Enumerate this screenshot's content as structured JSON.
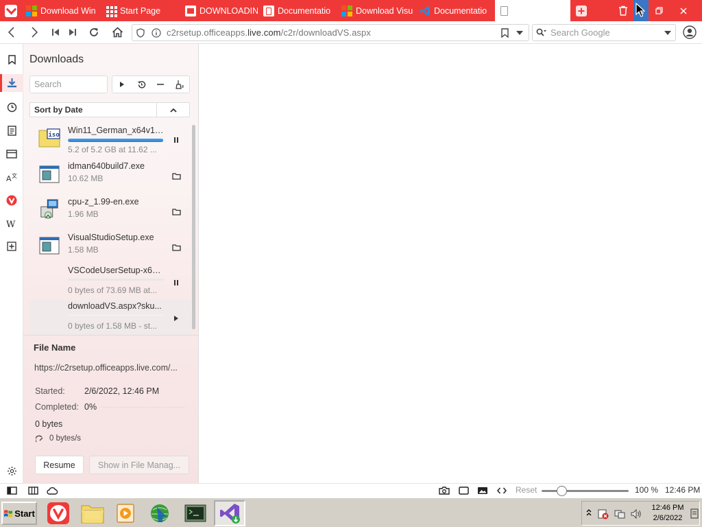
{
  "window": {
    "tabs": [
      {
        "title": "Download Win",
        "icon": "microsoft-logo-icon"
      },
      {
        "title": "Start Page",
        "icon": "speed-dial-grid-icon"
      },
      {
        "title": "DOWNLOADIN",
        "icon": "download-site-favicon"
      },
      {
        "title": "Documentatio",
        "icon": "document-favicon"
      },
      {
        "title": "Download Visu",
        "icon": "microsoft-logo-icon"
      },
      {
        "title": "Documentatio",
        "icon": "vscode-logo-icon"
      },
      {
        "title": "",
        "icon": "blank-page-icon"
      }
    ],
    "active_tab_index": 6
  },
  "address_bar": {
    "url_domain_prefix": "c2rsetup.officeapps.",
    "url_domain_main": "live.com",
    "url_path": "/c2r/downloadVS.aspx",
    "search_placeholder": "Search Google"
  },
  "panel": {
    "title": "Downloads",
    "search_placeholder": "Search",
    "sort_label": "Sort by Date",
    "downloads": [
      {
        "name": "Win11_German_x64v1....",
        "status": "5.2 of 5.2 GB at 11.62 ...",
        "progress": 0.99,
        "action": "pause-icon",
        "icon": "iso-file-icon"
      },
      {
        "name": "idman640build7.exe",
        "status": "10.62 MB",
        "action": "folder-icon",
        "icon": "exe-file-icon"
      },
      {
        "name": "cpu-z_1.99-en.exe",
        "status": "1.96 MB",
        "action": "folder-icon",
        "icon": "installer-file-icon"
      },
      {
        "name": "VisualStudioSetup.exe",
        "status": "1.58 MB",
        "action": "folder-icon",
        "icon": "exe-file-icon"
      },
      {
        "name": "VSCodeUserSetup-x64...",
        "status": "0 bytes of 73.69 MB at...",
        "progress": 0.0,
        "action": "pause-icon",
        "icon": ""
      },
      {
        "name": "downloadVS.aspx?sku...",
        "status": "0 bytes of 1.58 MB - st...",
        "progress": 0.0,
        "action": "play-icon",
        "icon": ""
      }
    ],
    "details": {
      "file_name_label": "File Name",
      "url": "https://c2rsetup.officeapps.live.com/...",
      "started_label": "Started:",
      "started_value": "2/6/2022, 12:46 PM",
      "completed_label": "Completed:",
      "completed_value": "0%",
      "size": "0 bytes",
      "speed": "0 bytes/s",
      "resume_label": "Resume",
      "show_in_fm_label": "Show in File Manag..."
    }
  },
  "status_bar": {
    "zoom_reset_label": "Reset",
    "zoom_value": "100 %",
    "clock": "12:46 PM",
    "zoom_level": 0.2
  },
  "taskbar": {
    "start_label": "Start",
    "tray_time": "12:46 PM",
    "tray_date": "2/6/2022"
  },
  "colors": {
    "vivaldi_red": "#ef3939",
    "progress_blue": "#2f7fcd",
    "taskbar_gray": "#d4d0c8"
  }
}
